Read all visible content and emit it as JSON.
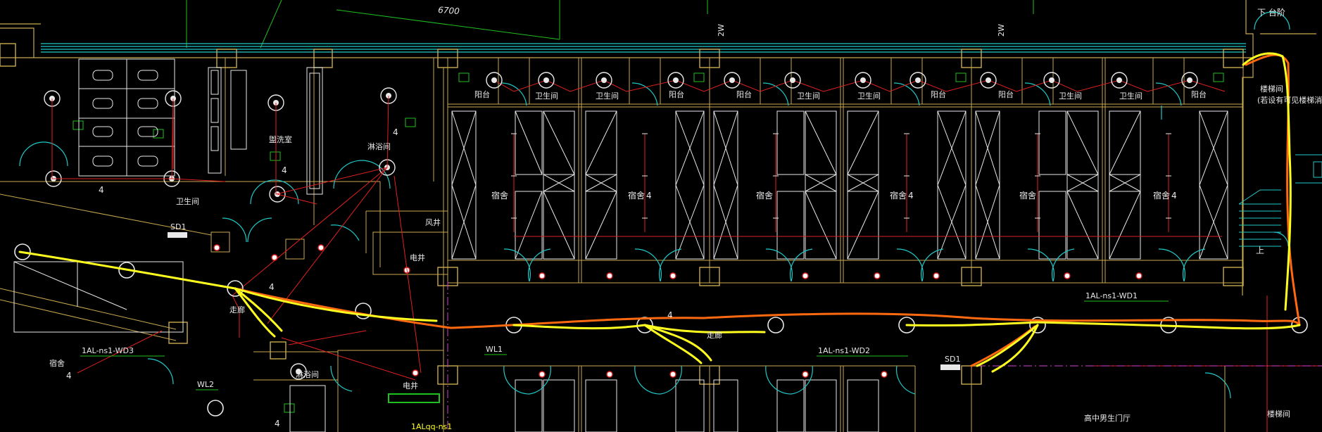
{
  "drawing": {
    "dimension_top": "6700",
    "stair_label": "下 台阶",
    "stair_up": "上",
    "fire_note_line1": "楼梯间",
    "fire_note_line2": "(若设有可见楼梯消防",
    "circuit_wd1": "1AL-ns1-WD1",
    "circuit_wd2": "1AL-ns1-WD2",
    "circuit_wd3": "1AL-ns1-WD3",
    "circuit_wl1": "WL1",
    "circuit_wl2": "WL2",
    "panel_sd1_left": "SD1",
    "panel_sd1_right": "SD1",
    "panel_bottom": "1ALqq-ns1",
    "room_toilet_left": "卫生间",
    "room_wash": "盥洗室",
    "room_shower": "淋浴间",
    "room_shaft_wind": "风井",
    "room_shaft_elec_top": "电井",
    "room_shaft_elec_bottom": "电井",
    "room_shower_bottom": "淋浴间",
    "room_dorm_bottom_left": "宿舍",
    "room_hall": "高中男生门厅",
    "room_corner": "楼梯间",
    "walkway": "走廊",
    "walkway2": "走廊",
    "count_4": "4",
    "dorms": [
      {
        "name": "宿舍",
        "count": ""
      },
      {
        "name": "宿舍",
        "count": "4"
      },
      {
        "name": "宿舍",
        "count": ""
      },
      {
        "name": "宿舍",
        "count": "4"
      },
      {
        "name": "宿舍",
        "count": ""
      },
      {
        "name": "宿舍",
        "count": "4"
      }
    ],
    "balcony_labels": [
      "阳台",
      "卫生间",
      "卫生间",
      "阳台",
      "阳台",
      "卫生间",
      "卫生间",
      "阳台",
      "阳台",
      "卫生间",
      "卫生间",
      "阳台"
    ],
    "marks_2w": [
      "2W",
      "2W"
    ]
  },
  "colors": {
    "background": "#000000",
    "wall_yellow": "#c8a850",
    "wall_white": "#e8e8e8",
    "window_cyan": "#20c8c8",
    "wire_red": "#e02020",
    "highlight_yellow": "#ffff20",
    "highlight_orange": "#ff6a10",
    "grid_green": "#20c020",
    "magenta": "#d040d0"
  }
}
